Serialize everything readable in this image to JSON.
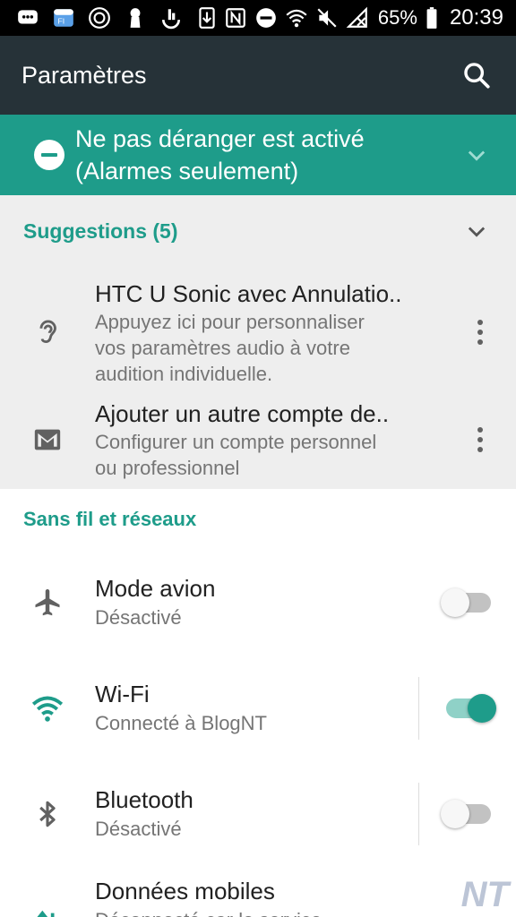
{
  "status_bar": {
    "battery_percent": "65%",
    "time": "20:39",
    "left_icons": [
      "chat-bubble-icon",
      "wallpaper-app-icon",
      "circle-app-icon",
      "keyhole-icon",
      "hand-app-icon",
      "download-icon"
    ],
    "right_icons": [
      "nfc-icon",
      "do-not-disturb-icon",
      "wifi-icon",
      "mute-icon",
      "signal-off-icon",
      "battery-icon"
    ]
  },
  "app_bar": {
    "title": "Paramètres",
    "search_icon": "search-icon"
  },
  "dnd_banner": {
    "line1": "Ne pas déranger est activé",
    "line2": "(Alarmes seulement)",
    "color": "#1e9c8a"
  },
  "suggestions": {
    "title": "Suggestions (5)",
    "items": [
      {
        "icon": "ear-icon",
        "title": "HTC U Sonic avec Annulatio..",
        "line1": "Appuyez ici pour personnaliser",
        "line2": "vos paramètres audio à votre",
        "line3": "audition individuelle."
      },
      {
        "icon": "gmail-icon",
        "title": "Ajouter un autre compte de..",
        "line1": "Configurer un compte personnel",
        "line2": "ou professionnel"
      }
    ]
  },
  "wireless_section": {
    "title": "Sans fil et réseaux",
    "settings": [
      {
        "icon": "airplane-icon",
        "title": "Mode avion",
        "status": "Désactivé",
        "enabled": false
      },
      {
        "icon": "wifi-icon",
        "title": "Wi-Fi",
        "status": "Connecté à BlogNT",
        "enabled": true
      },
      {
        "icon": "bluetooth-icon",
        "title": "Bluetooth",
        "status": "Désactivé",
        "enabled": false
      },
      {
        "icon": "mobile-data-icon",
        "title": "Données mobiles",
        "status": "Déconnecté car le service",
        "enabled": false
      }
    ]
  },
  "watermark": "NT",
  "colors": {
    "accent": "#1e9c8a",
    "app_bar": "#263238",
    "suggestions_bg": "#eeeeee"
  }
}
